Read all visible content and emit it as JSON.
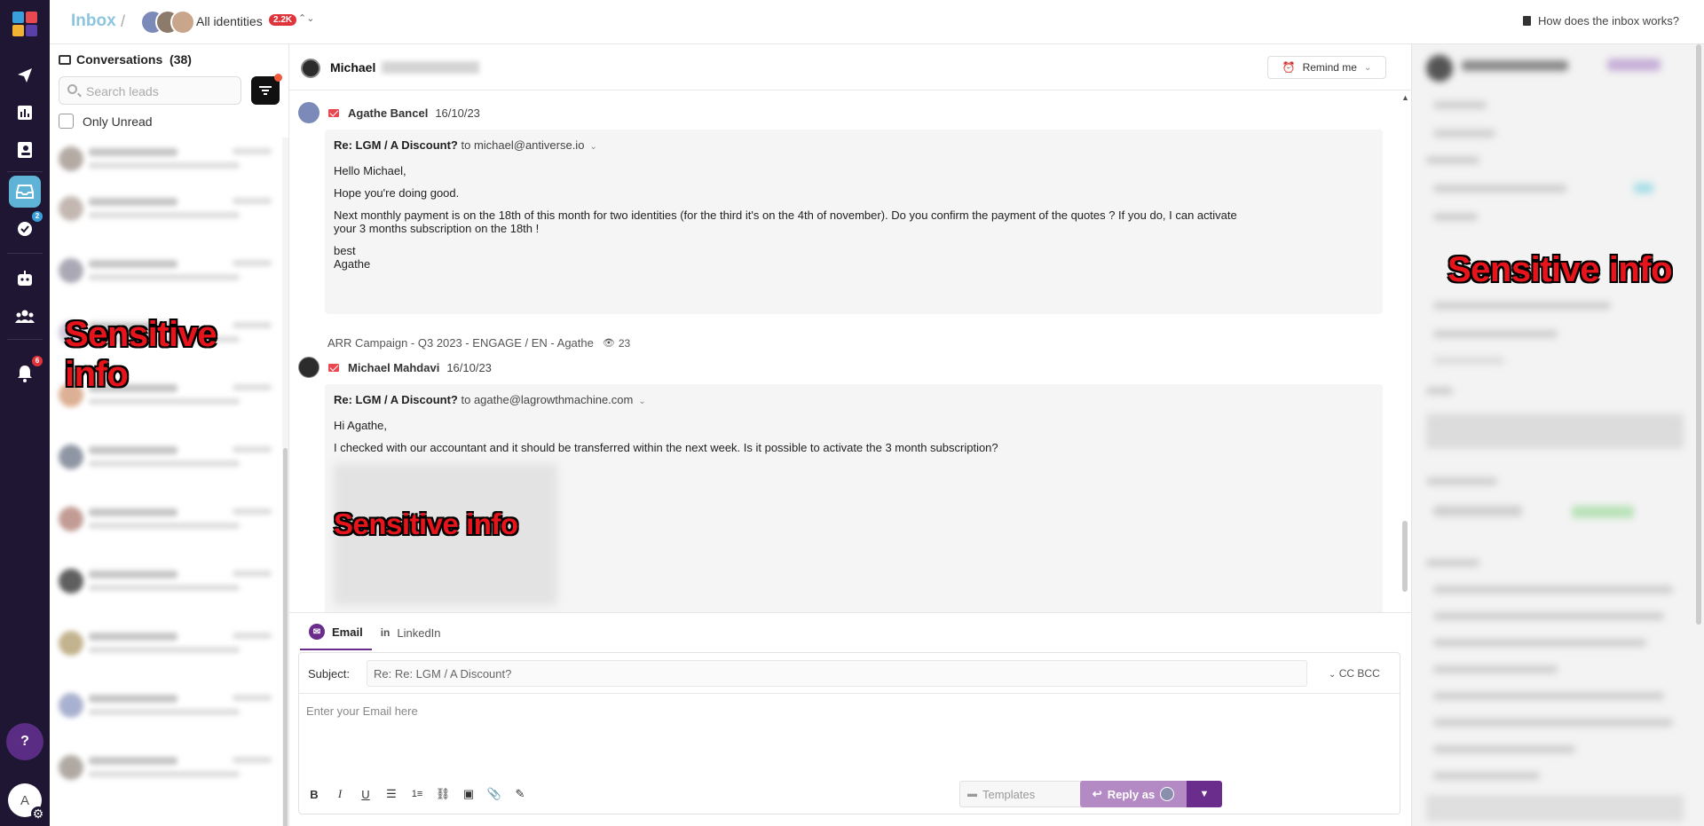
{
  "header": {
    "title": "Inbox",
    "separator": "/",
    "identities_label": "All identities",
    "identities_count": "2.2K",
    "help_link": "How does the inbox works?"
  },
  "rail": {
    "tasks_badge": "2",
    "notifications_badge": "6",
    "help_label": "?",
    "user_initial": "A"
  },
  "conversations": {
    "title": "Conversations",
    "count": "(38)",
    "search_placeholder": "Search leads",
    "only_unread_label": "Only Unread",
    "redaction_label": "Sensitive info"
  },
  "thread": {
    "contact_name": "Michael",
    "remind_label": "Remind me",
    "messages": [
      {
        "from": "Agathe Bancel",
        "date": "16/10/23",
        "subject": "Re: LGM / A Discount?",
        "to": "to michael@antiverse.io",
        "paragraphs": [
          "Hello Michael,",
          "Hope you're doing good.",
          "Next monthly payment is on the 18th of this month for two identities (for the third it's on the 4th of november). Do you confirm the payment of the quotes ? If you do, I can activate your 3 months subscription on the 18th !",
          "best",
          "Agathe"
        ]
      },
      {
        "from": "Michael Mahdavi",
        "date": "16/10/23",
        "subject": "Re: LGM / A Discount?",
        "to": "to agathe@lagrowthmachine.com",
        "paragraphs": [
          "Hi Agathe,",
          "I checked with our accountant and it should be transferred within the next week. Is it possible to activate the 3 month subscription?"
        ],
        "redaction_label": "Sensitive info"
      }
    ],
    "campaign_label": "ARR Campaign - Q3 2023 - ENGAGE / EN - Agathe",
    "campaign_views": "23"
  },
  "composer": {
    "tabs": [
      {
        "label": "Email",
        "active": true
      },
      {
        "label": "LinkedIn",
        "active": false
      }
    ],
    "subject_label": "Subject:",
    "subject_value": "Re: Re: LGM / A Discount?",
    "cc_bcc_label": "CC BCC",
    "body_placeholder": "Enter your Email here",
    "templates_label": "Templates",
    "reply_label": "Reply as"
  },
  "right_panel": {
    "redaction_label": "Sensitive info"
  },
  "colors": {
    "rail_bg": "#1e1633",
    "accent": "#6a2d8c",
    "reply_btn": "#b48ac5",
    "badge_red": "#e0343a",
    "inbox_blue": "#5fb3d6"
  }
}
